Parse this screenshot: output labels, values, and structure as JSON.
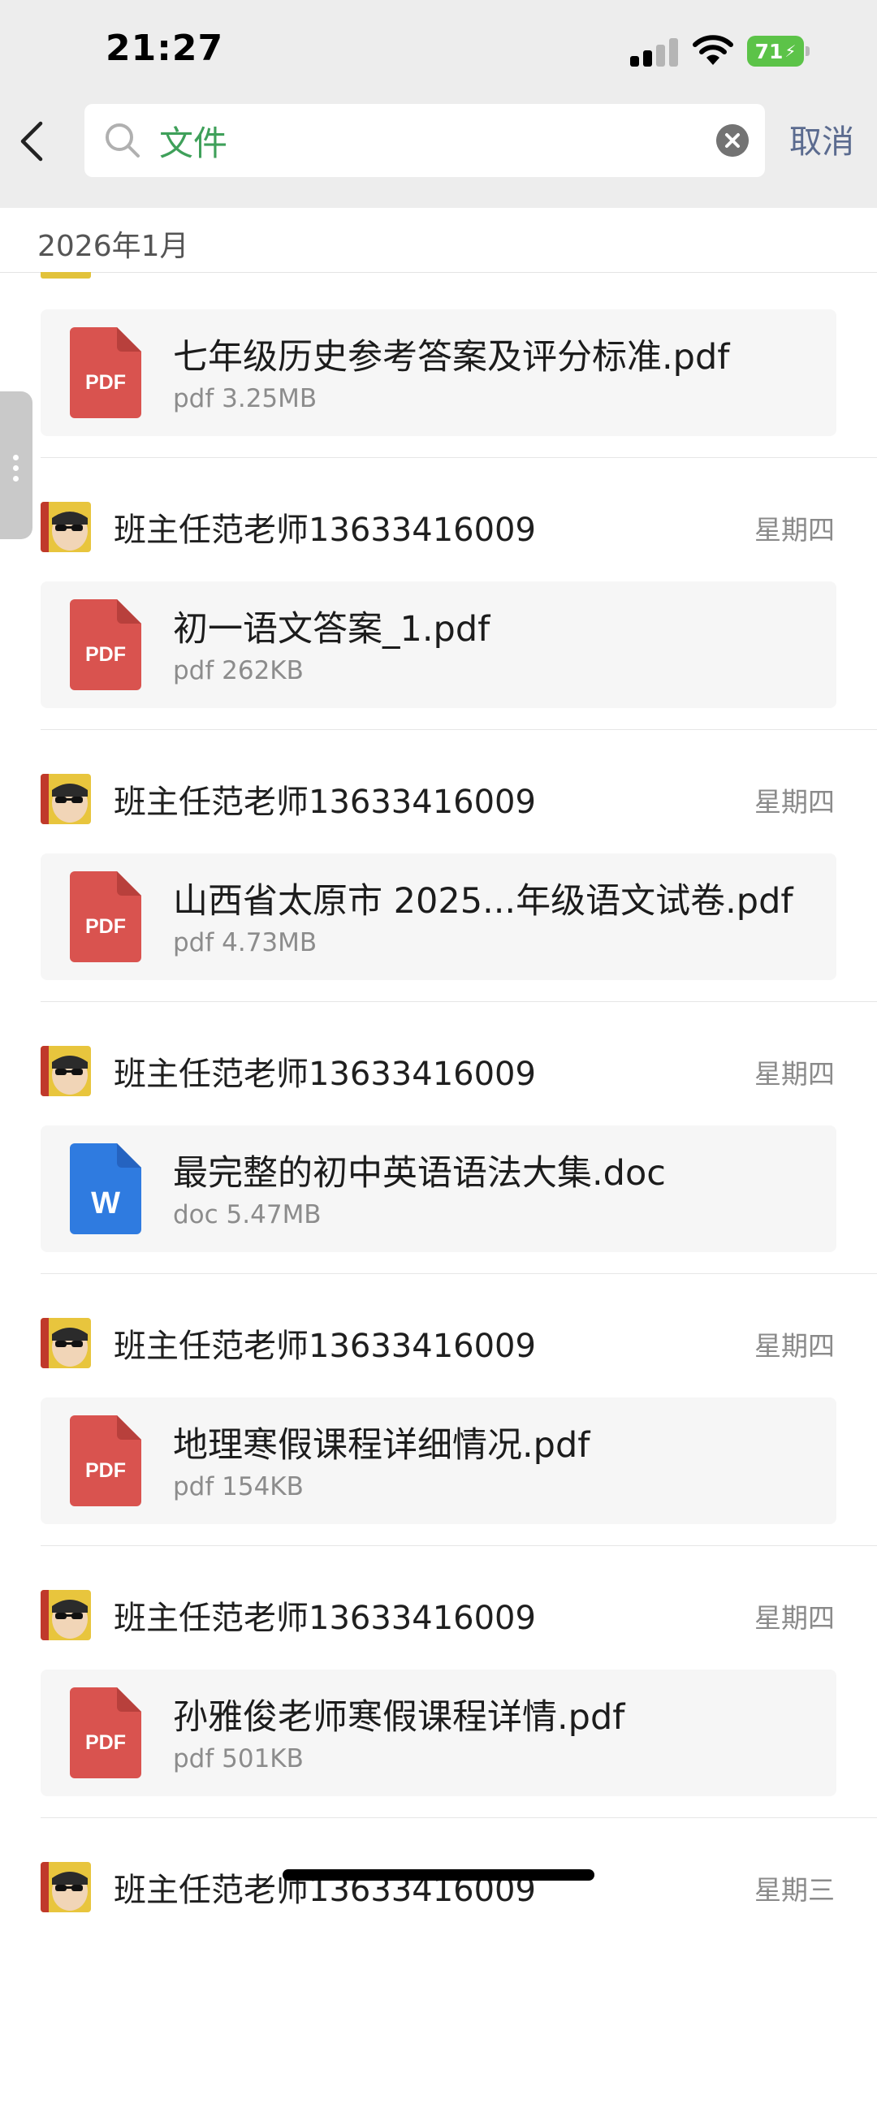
{
  "status_bar": {
    "time": "21:27",
    "battery": "71",
    "battery_color": "#5cc348",
    "icons": [
      "cellular-signal-icon",
      "wifi-icon",
      "battery-charging-icon"
    ]
  },
  "search": {
    "query": "文件",
    "query_color": "#3fa05a",
    "cancel_label": "取消",
    "icons": [
      "back-chevron-icon",
      "search-icon",
      "clear-icon"
    ]
  },
  "month_header": "2026年1月",
  "first_file": {
    "name": "七年级历史参考答案及评分标准.pdf",
    "meta": "pdf 3.25MB",
    "type": "pdf"
  },
  "entries": [
    {
      "sender": "班主任范老师13633416009",
      "date": "星期四",
      "file": {
        "name": "初一语文答案_1.pdf",
        "meta": "pdf 262KB",
        "type": "pdf"
      }
    },
    {
      "sender": "班主任范老师13633416009",
      "date": "星期四",
      "file": {
        "name": "山西省太原市 2025...年级语文试卷.pdf",
        "meta": "pdf 4.73MB",
        "type": "pdf"
      }
    },
    {
      "sender": "班主任范老师13633416009",
      "date": "星期四",
      "file": {
        "name": "最完整的初中英语语法大集.doc",
        "meta": "doc 5.47MB",
        "type": "doc"
      }
    },
    {
      "sender": "班主任范老师13633416009",
      "date": "星期四",
      "file": {
        "name": "地理寒假课程详细情况.pdf",
        "meta": "pdf 154KB",
        "type": "pdf"
      }
    },
    {
      "sender": "班主任范老师13633416009",
      "date": "星期四",
      "file": {
        "name": "孙雅俊老师寒假课程详情.pdf",
        "meta": "pdf 501KB",
        "type": "pdf"
      }
    },
    {
      "sender": "班主任范老师13633416009",
      "date": "星期三"
    }
  ],
  "file_icon_labels": {
    "pdf": "PDF",
    "doc": "W"
  },
  "colors": {
    "pdf_icon": "#d9534f",
    "doc_icon": "#2f7be0",
    "cancel": "#5b6b8f"
  }
}
